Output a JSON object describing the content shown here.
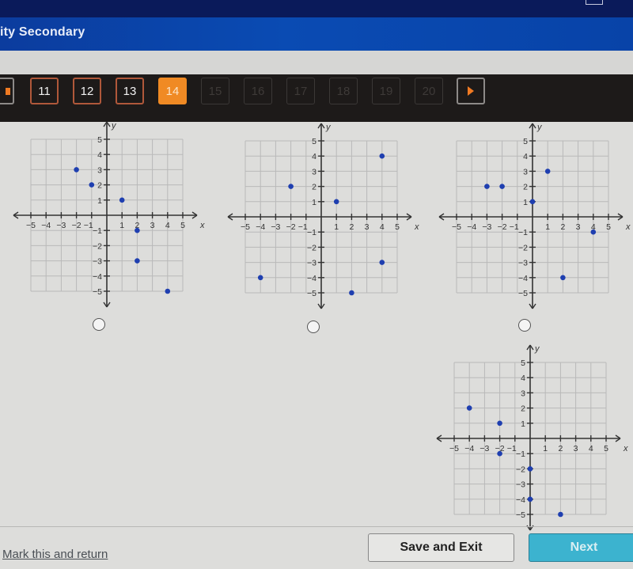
{
  "window": {
    "title": "ity Secondary"
  },
  "navigation": {
    "prev_icon": "caret-left-icon",
    "buttons": [
      {
        "label": "11",
        "state": "answered"
      },
      {
        "label": "12",
        "state": "answered"
      },
      {
        "label": "13",
        "state": "answered"
      },
      {
        "label": "14",
        "state": "current"
      },
      {
        "label": "15",
        "state": "disabled"
      },
      {
        "label": "16",
        "state": "disabled"
      },
      {
        "label": "17",
        "state": "disabled"
      },
      {
        "label": "18",
        "state": "disabled"
      },
      {
        "label": "19",
        "state": "disabled"
      },
      {
        "label": "20",
        "state": "disabled"
      }
    ],
    "next_icon": "caret-right-icon"
  },
  "colors": {
    "accent_orange": "#f08a24",
    "point_blue": "#1f3fb0",
    "next_button": "#3cb3cf",
    "title_bar": "#0a4bb3"
  },
  "chart_data": [
    {
      "type": "scatter",
      "option": 1,
      "xlabel": "x",
      "ylabel": "y",
      "xlim": [
        -5,
        5
      ],
      "ylim": [
        -5,
        5
      ],
      "x_ticks": [
        "-5",
        "-4",
        "-3",
        "-2",
        "-1",
        "1",
        "2",
        "3",
        "4",
        "5"
      ],
      "y_ticks": [
        "5",
        "4",
        "3",
        "2",
        "1",
        "-1",
        "-2",
        "-3",
        "-4",
        "-5"
      ],
      "grid": true,
      "points": [
        [
          -2,
          3
        ],
        [
          -1,
          2
        ],
        [
          1,
          1
        ],
        [
          2,
          -1
        ],
        [
          2,
          -3
        ],
        [
          4,
          -5
        ]
      ]
    },
    {
      "type": "scatter",
      "option": 2,
      "xlabel": "x",
      "ylabel": "y",
      "xlim": [
        -5,
        5
      ],
      "ylim": [
        -5,
        5
      ],
      "x_ticks": [
        "-5",
        "-4",
        "-3",
        "-2",
        "-1",
        "1",
        "2",
        "3",
        "4",
        "5"
      ],
      "y_ticks": [
        "5",
        "4",
        "3",
        "2",
        "1",
        "-1",
        "-2",
        "-3",
        "-4",
        "-5"
      ],
      "grid": true,
      "points": [
        [
          -2,
          2
        ],
        [
          1,
          1
        ],
        [
          4,
          4
        ],
        [
          -4,
          -4
        ],
        [
          2,
          -5
        ],
        [
          4,
          -3
        ]
      ]
    },
    {
      "type": "scatter",
      "option": 3,
      "xlabel": "x",
      "ylabel": "y",
      "xlim": [
        -5,
        5
      ],
      "ylim": [
        -5,
        5
      ],
      "x_ticks": [
        "-5",
        "-4",
        "-3",
        "-2",
        "-1",
        "1",
        "2",
        "3",
        "4",
        "5"
      ],
      "y_ticks": [
        "5",
        "4",
        "3",
        "2",
        "1",
        "-1",
        "-2",
        "-3",
        "-4",
        "-5"
      ],
      "grid": true,
      "points": [
        [
          -3,
          2
        ],
        [
          -2,
          2
        ],
        [
          0,
          1
        ],
        [
          1,
          3
        ],
        [
          4,
          -1
        ],
        [
          2,
          -4
        ]
      ]
    },
    {
      "type": "scatter",
      "option": 4,
      "xlabel": "x",
      "ylabel": "y",
      "xlim": [
        -5,
        5
      ],
      "ylim": [
        -5,
        5
      ],
      "x_ticks": [
        "-5",
        "-4",
        "-3",
        "-2",
        "-1",
        "1",
        "2",
        "3",
        "4",
        "5"
      ],
      "y_ticks": [
        "5",
        "4",
        "3",
        "2",
        "1",
        "-1",
        "-2",
        "-3",
        "-4",
        "-5"
      ],
      "grid": true,
      "points": [
        [
          -4,
          2
        ],
        [
          -2,
          1
        ],
        [
          -2,
          -1
        ],
        [
          0,
          -2
        ],
        [
          0,
          -4
        ],
        [
          2,
          -5
        ]
      ]
    }
  ],
  "footer": {
    "mark_link": "Mark this and return",
    "save_button": "Save and Exit",
    "next_button": "Next"
  }
}
